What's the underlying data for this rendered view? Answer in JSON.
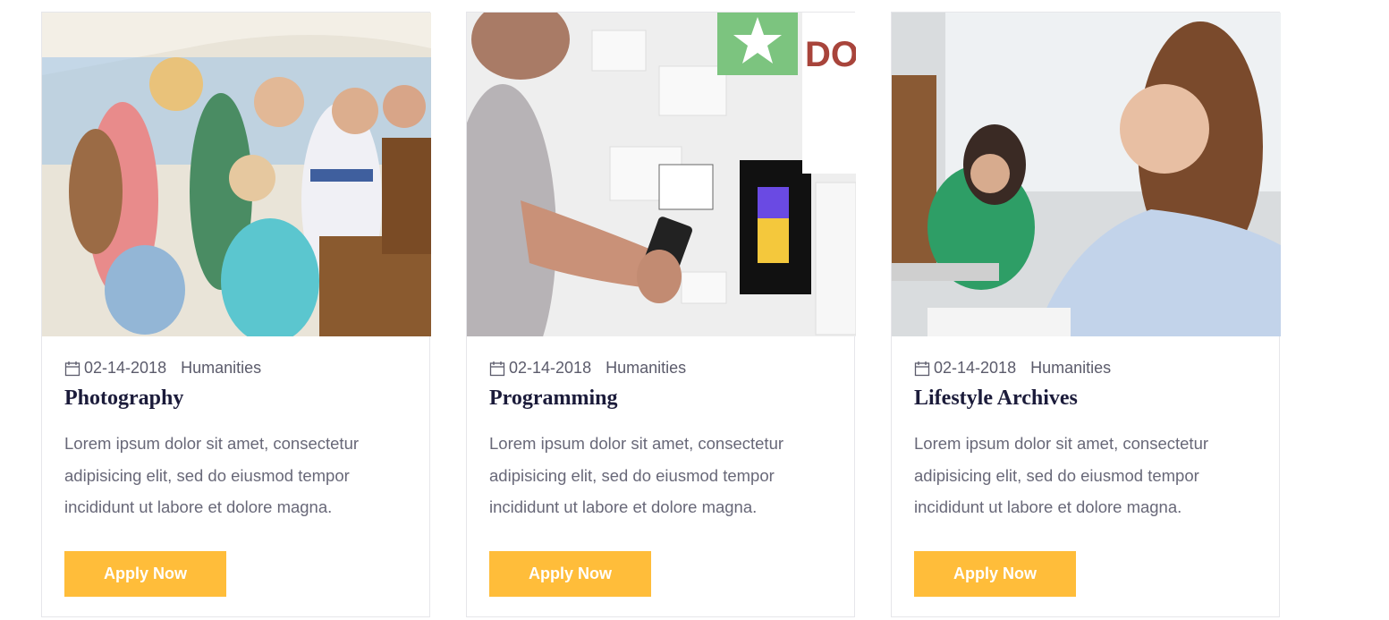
{
  "cards": [
    {
      "image_alt": "Teenagers gathered around a piano",
      "date": "02-14-2018",
      "category": "Humanities",
      "title": "Photography",
      "description": "Lorem ipsum dolor sit amet, consectetur adipisicing elit, sed do eiusmod tempor incididunt ut labore et dolore magna.",
      "button_label": "Apply Now"
    },
    {
      "image_alt": "Man using a smartphone in front of a wall of notes",
      "date": "02-14-2018",
      "category": "Humanities",
      "title": "Programming",
      "description": "Lorem ipsum dolor sit amet, consectetur adipisicing elit, sed do eiusmod tempor incididunt ut labore et dolore magna.",
      "button_label": "Apply Now",
      "image_wall_text": "DON LOO BAC"
    },
    {
      "image_alt": "Student writing in a classroom",
      "date": "02-14-2018",
      "category": "Humanities",
      "title": "Lifestyle Archives",
      "description": "Lorem ipsum dolor sit amet, consectetur adipisicing elit, sed do eiusmod tempor incididunt ut labore et dolore magna.",
      "button_label": "Apply Now"
    }
  ],
  "colors": {
    "accent": "#ffbd3a",
    "title": "#1b1b3a",
    "body_text": "#686878",
    "meta_text": "#5b5b6b",
    "border": "#e6e6ea"
  },
  "icons": {
    "date": "calendar-icon"
  }
}
